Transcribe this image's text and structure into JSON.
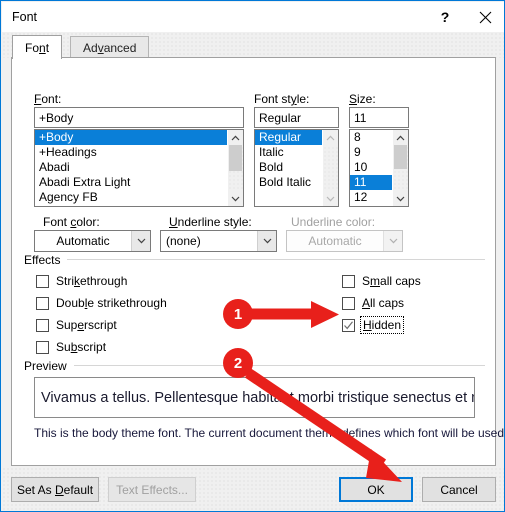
{
  "window": {
    "title": "Font",
    "help_label": "?",
    "close_label": "close-icon",
    "accent_color": "#0078d7",
    "selection_color": "#0a7fd8",
    "annotation_color": "#e8201b"
  },
  "tabs": [
    {
      "label": "Font",
      "accel_index": 2,
      "active": true
    },
    {
      "label": "Advanced",
      "accel_index": 3,
      "active": false
    }
  ],
  "font_section": {
    "font_label": "Font:",
    "font_value": "+Body",
    "font_options": [
      "+Body",
      "+Headings",
      "Abadi",
      "Abadi Extra Light",
      "Agency FB"
    ],
    "font_selected": "+Body",
    "style_label": "Font style:",
    "style_value": "Regular",
    "style_options": [
      "Regular",
      "Italic",
      "Bold",
      "Bold Italic"
    ],
    "style_selected": "Regular",
    "size_label": "Size:",
    "size_value": "11",
    "size_options": [
      "8",
      "9",
      "10",
      "11",
      "12"
    ],
    "size_selected": "11"
  },
  "color_row": {
    "font_color_label": "Font color:",
    "font_color_value": "Automatic",
    "underline_style_label": "Underline style:",
    "underline_style_value": "(none)",
    "underline_color_label": "Underline color:",
    "underline_color_value": "Automatic",
    "underline_color_disabled": true
  },
  "effects": {
    "group_label": "Effects",
    "left_items": [
      {
        "label": "Strikethrough",
        "checked": false
      },
      {
        "label": "Double strikethrough",
        "checked": false
      },
      {
        "label": "Superscript",
        "checked": false
      },
      {
        "label": "Subscript",
        "checked": false
      }
    ],
    "right_items": [
      {
        "label": "Small caps",
        "checked": false
      },
      {
        "label": "All caps",
        "checked": false
      },
      {
        "label": "Hidden",
        "checked": true,
        "focused": true
      }
    ]
  },
  "preview": {
    "group_label": "Preview",
    "sample_text": "Vivamus a tellus. Pellentesque habitant morbi tristique senectus et netus",
    "note": "This is the body theme font. The current document theme defines which font will be used."
  },
  "footer": {
    "set_as_default": "Set As Default",
    "text_effects": "Text Effects...",
    "text_effects_disabled": true,
    "ok": "OK",
    "cancel": "Cancel"
  },
  "annotations": [
    {
      "number": "1",
      "target": "hidden-checkbox"
    },
    {
      "number": "2",
      "target": "ok-button"
    }
  ]
}
